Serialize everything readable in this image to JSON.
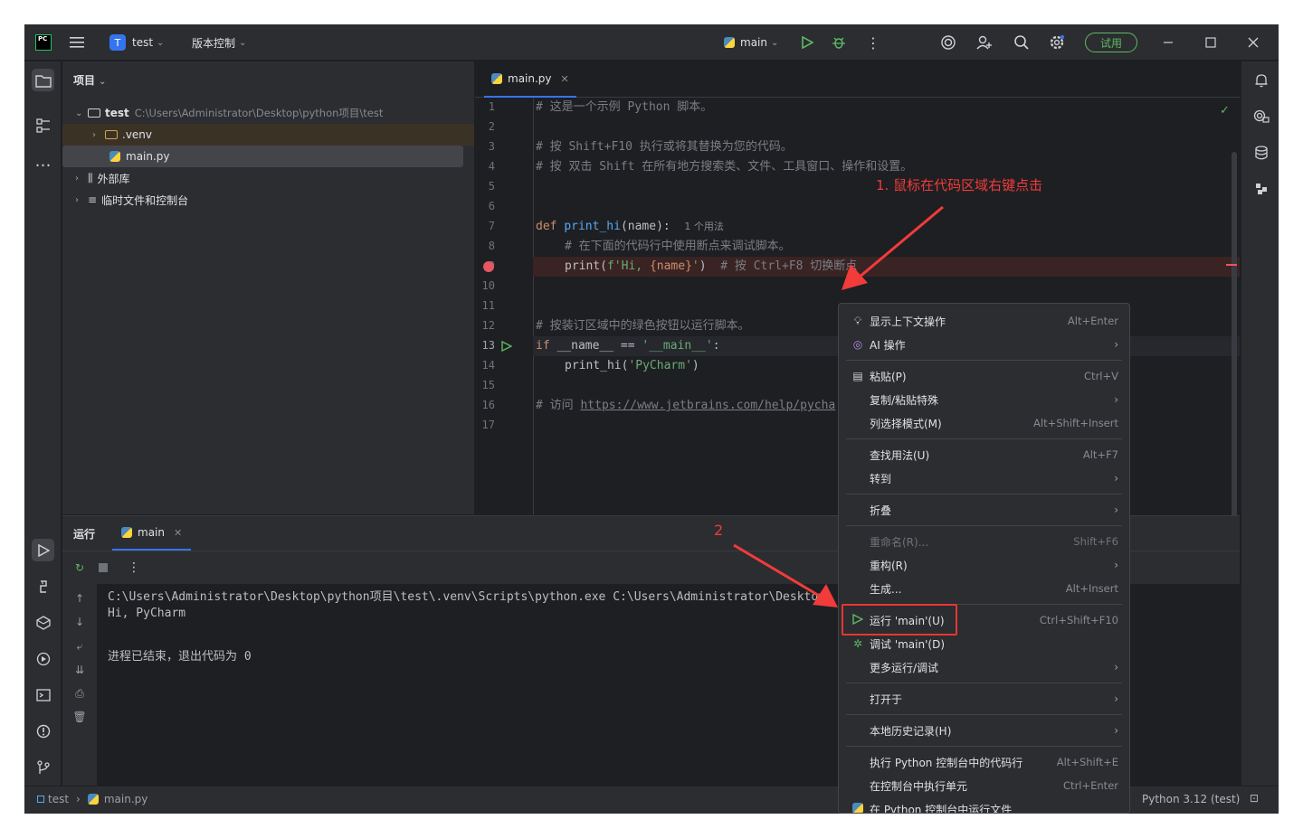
{
  "titlebar": {
    "logo": "PC",
    "project_badge": "T",
    "project_name": "test",
    "vcs_label": "版本控制",
    "run_config": "main",
    "trial_label": "试用"
  },
  "project_panel": {
    "title": "项目",
    "tree": [
      {
        "label": "test",
        "path": "C:\\Users\\Administrator\\Desktop\\python项目\\test"
      },
      {
        "label": ".venv"
      },
      {
        "label": "main.py"
      },
      {
        "label": "外部库"
      },
      {
        "label": "临时文件和控制台"
      }
    ]
  },
  "editor": {
    "tab_name": "main.py",
    "line_numbers": [
      "1",
      "2",
      "3",
      "4",
      "5",
      "6",
      "7",
      "8",
      "9",
      "10",
      "11",
      "12",
      "13",
      "14",
      "15",
      "16",
      "17"
    ],
    "code": {
      "l1": "# 这是一个示例 Python 脚本。",
      "l3": "# 按 Shift+F10 执行或将其替换为您的代码。",
      "l4": "# 按 双击 Shift 在所有地方搜索类、文件、工具窗口、操作和设置。",
      "l7_kw": "def ",
      "l7_fn": "print_hi",
      "l7_rest": "(name):",
      "l7_hint": "1 个用法",
      "l8": "# 在下面的代码行中使用断点来调试脚本。",
      "l9_code_a": "print(",
      "l9_str_a": "f'Hi, ",
      "l9_code_b": "{name}",
      "l9_str_b": "'",
      "l9_code_c": ")",
      "l9_comment": "# 按 Ctrl+F8 切换断点",
      "l12": "# 按装订区域中的绿色按钮以运行脚本。",
      "l13_kw": "if ",
      "l13_rest": "__name__ == ",
      "l13_str": "'__main__'",
      "l13_colon": ":",
      "l14_code": "print_hi(",
      "l14_str": "'PyCharm'",
      "l14_close": ")",
      "l16_comment": "# 访问 ",
      "l16_link": "https://www.jetbrains.com/help/pycha"
    }
  },
  "run_panel": {
    "title": "运行",
    "tab": "main",
    "console": [
      "C:\\Users\\Administrator\\Desktop\\python项目\\test\\.venv\\Scripts\\python.exe C:\\Users\\Administrator\\Desktop",
      "Hi, PyCharm",
      "",
      "进程已结束，退出代码为 0"
    ]
  },
  "status_bar": {
    "crumb_project": "test",
    "crumb_file": "main.py",
    "interpreter": "Python 3.12 (test)"
  },
  "context_menu": {
    "items": [
      {
        "label": "显示上下文操作",
        "shortcut": "Alt+Enter"
      },
      {
        "label": "AI 操作",
        "shortcut": ""
      },
      {
        "label": "粘贴(P)",
        "shortcut": "Ctrl+V"
      },
      {
        "label": "复制/粘贴特殊",
        "shortcut": ""
      },
      {
        "label": "列选择模式(M)",
        "shortcut": "Alt+Shift+Insert"
      },
      {
        "label": "查找用法(U)",
        "shortcut": "Alt+F7"
      },
      {
        "label": "转到",
        "shortcut": ""
      },
      {
        "label": "折叠",
        "shortcut": ""
      },
      {
        "label": "重命名(R)...",
        "shortcut": "Shift+F6"
      },
      {
        "label": "重构(R)",
        "shortcut": ""
      },
      {
        "label": "生成...",
        "shortcut": "Alt+Insert"
      },
      {
        "label": "运行 'main'(U)",
        "shortcut": "Ctrl+Shift+F10"
      },
      {
        "label": "调试 'main'(D)",
        "shortcut": ""
      },
      {
        "label": "更多运行/调试",
        "shortcut": ""
      },
      {
        "label": "打开于",
        "shortcut": ""
      },
      {
        "label": "本地历史记录(H)",
        "shortcut": ""
      },
      {
        "label": "执行 Python 控制台中的代码行",
        "shortcut": "Alt+Shift+E"
      },
      {
        "label": "在控制台中执行单元",
        "shortcut": "Ctrl+Enter"
      },
      {
        "label": "在 Python 控制台中运行文件",
        "shortcut": ""
      }
    ]
  },
  "annotations": {
    "step1": "1. 鼠标在代码区域右键点击",
    "step2": "2"
  },
  "colors": {
    "accent": "#3574f0",
    "annotation_red": "#f23b3b",
    "run_green": "#5fb865",
    "breakpoint_red": "#e55765"
  }
}
